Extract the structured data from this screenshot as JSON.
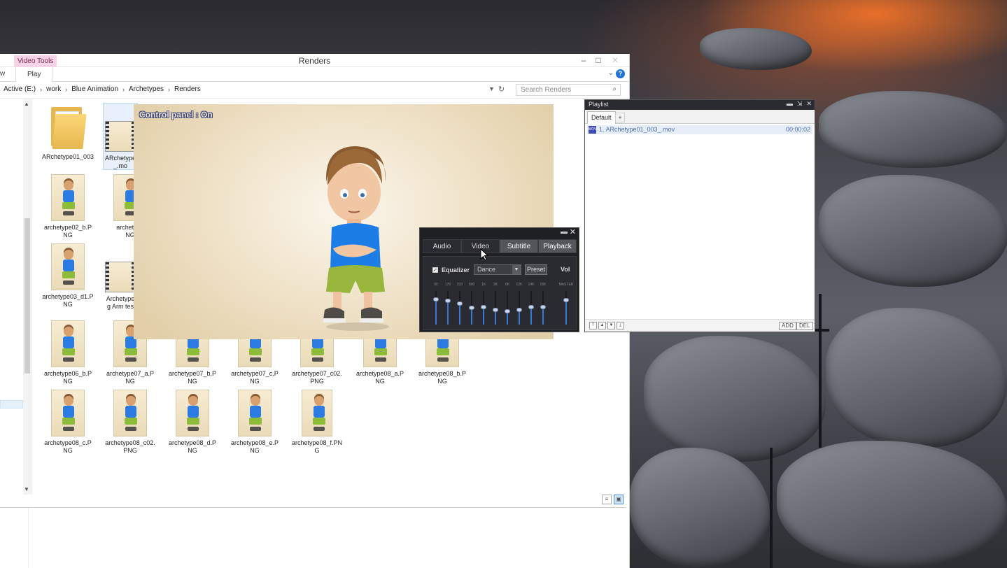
{
  "explorer": {
    "title": "Renders",
    "context_tab": "Video Tools",
    "ribbon_tab_partial": "w",
    "ribbon_tab_play": "Play",
    "breadcrumb": [
      "Active (E:)",
      "work",
      "Blue Animation",
      "Archetypes",
      "Renders"
    ],
    "search_placeholder": "Search Renders",
    "files": [
      {
        "label": "ARchetype01_003",
        "kind": "folder"
      },
      {
        "label": "ARchetype\n_.mo",
        "kind": "video"
      },
      {
        "label": "archetype02_b.P\nNG",
        "kind": "image"
      },
      {
        "label": "archetype\nNG",
        "kind": "image"
      },
      {
        "label": "archetype03_d1.P\nNG",
        "kind": "image"
      },
      {
        "label": "Archetype\ng Arm tes",
        "kind": "video"
      },
      {
        "label": "archetype06_b.P\nNG",
        "kind": "image"
      },
      {
        "label": "archetype07_a.P\nNG",
        "kind": "image"
      },
      {
        "label": "archetype07_b.P\nNG",
        "kind": "image"
      },
      {
        "label": "archetype07_c.P\nNG",
        "kind": "image"
      },
      {
        "label": "archetype07_c02.\nPNG",
        "kind": "image"
      },
      {
        "label": "archetype08_a.P\nNG",
        "kind": "image"
      },
      {
        "label": "archetype08_b.P\nNG",
        "kind": "image"
      },
      {
        "label": "archetype08_c.P\nNG",
        "kind": "image"
      },
      {
        "label": "archetype08_c02.\nPNG",
        "kind": "image"
      },
      {
        "label": "archetype08_d.P\nNG",
        "kind": "image"
      },
      {
        "label": "archetype08_e.P\nNG",
        "kind": "image"
      },
      {
        "label": "archetype08_f.PN\nG",
        "kind": "image"
      }
    ]
  },
  "player": {
    "osd_text": "Control panel : On"
  },
  "control_panel": {
    "tabs": [
      "Audio",
      "Video",
      "Subtitle",
      "Playback"
    ],
    "active_tab": "Video",
    "equalizer_label": "Equalizer",
    "equalizer_enabled": true,
    "preset_value": "Dance",
    "preset_button": "Preset",
    "vol_label": "Vol",
    "bands": [
      {
        "label": "60",
        "level": 0.75
      },
      {
        "label": "170",
        "level": 0.7
      },
      {
        "label": "310",
        "level": 0.62
      },
      {
        "label": "600",
        "level": 0.5
      },
      {
        "label": "1K",
        "level": 0.52
      },
      {
        "label": "3K",
        "level": 0.44
      },
      {
        "label": "6K",
        "level": 0.4
      },
      {
        "label": "12K",
        "level": 0.44
      },
      {
        "label": "14K",
        "level": 0.52
      },
      {
        "label": "16K",
        "level": 0.52
      }
    ],
    "master": {
      "label": "MASTER",
      "level": 0.72
    }
  },
  "playlist": {
    "title": "Playlist",
    "tab_default": "Default",
    "tab_add": "+",
    "items": [
      {
        "name": "1. ARchetype01_003_.mov",
        "duration": "00:00:02"
      }
    ],
    "add_button": "ADD",
    "del_button": "DEL"
  }
}
